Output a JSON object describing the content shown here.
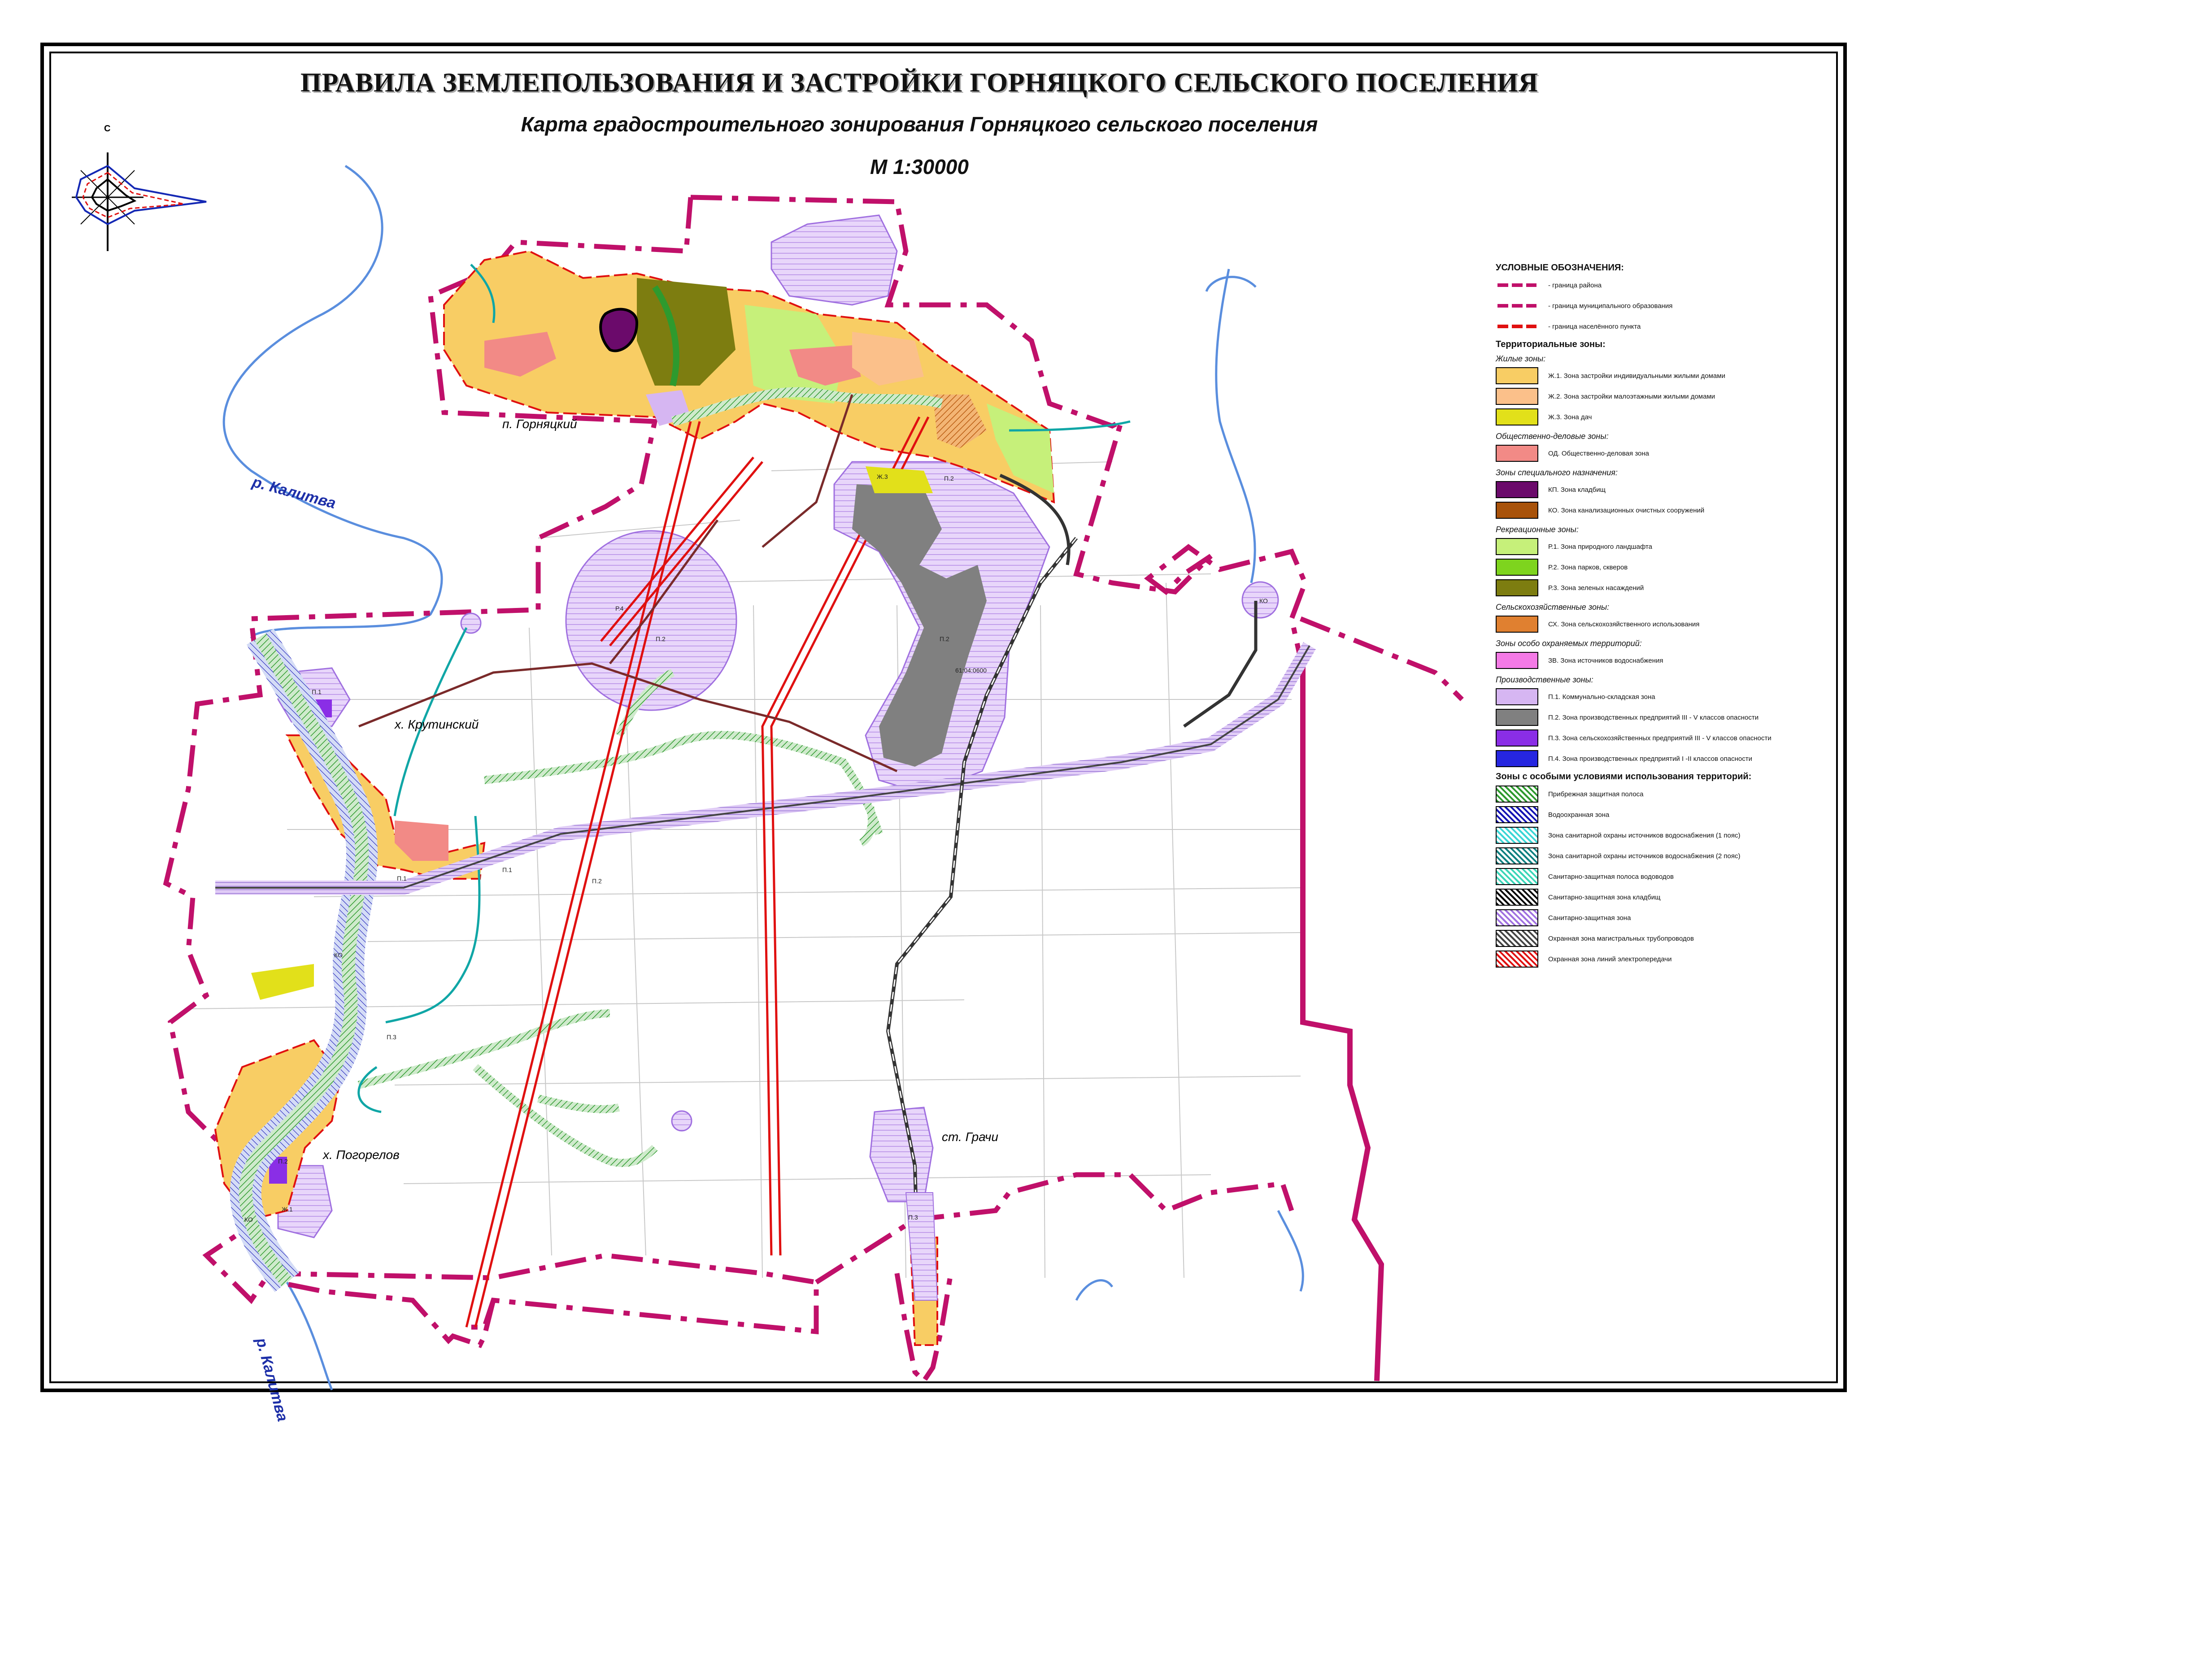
{
  "header": {
    "title": "ПРАВИЛА ЗЕМЛЕПОЛЬЗОВАНИЯ И ЗАСТРОЙКИ ГОРНЯЦКОГО СЕЛЬСКОГО ПОСЕЛЕНИЯ",
    "subtitle": "Карта градостроительного зонирования Горняцкого сельского поселения",
    "scale": "М 1:30000"
  },
  "compass": {
    "north_label": "С"
  },
  "places": {
    "gornyatsky": "п. Горняцкий",
    "krutinsky": "х. Крутинский",
    "pogorelov": "х. Погорелов",
    "grachi": "ст. Грачи"
  },
  "rivers": {
    "kalitva_north": "р. Калитва",
    "kalitva_south": "р. Калитва"
  },
  "map_codes": [
    "Ж.3",
    "П.2",
    "П.2",
    "П.2",
    "Р.4",
    "П.1",
    "КО",
    "П.1",
    "П.3",
    "П.2",
    "КО",
    "Ж.1",
    "П.3",
    "П.1",
    "КО",
    "П.2"
  ],
  "map_cadastre_label": "61:04:0600",
  "legend": {
    "title": "УСЛОВНЫЕ ОБОЗНАЧЕНИЯ:",
    "boundaries": [
      {
        "label": "- граница района",
        "color": "#c0106a"
      },
      {
        "label": "- граница муниципального образования",
        "color": "#c0106a"
      },
      {
        "label": "- граница населённого пункта",
        "color": "#e01010"
      }
    ],
    "territorial_title": "Территориальные зоны:",
    "groups": [
      {
        "name": "Жилые зоны:",
        "items": [
          {
            "label": "Ж.1. Зона застройки индивидуальными жилыми домами",
            "color": "#f8cd64"
          },
          {
            "label": "Ж.2. Зона застройки малоэтажными жилыми домами",
            "color": "#fbc08a"
          },
          {
            "label": "Ж.3. Зона дач",
            "color": "#e2e01a"
          }
        ]
      },
      {
        "name": "Общественно-деловые зоны:",
        "items": [
          {
            "label": "ОД. Общественно-деловая зона",
            "color": "#f28a86"
          }
        ]
      },
      {
        "name": "Зоны специального назначения:",
        "items": [
          {
            "label": "КП. Зона кладбищ",
            "color": "#6b0a6b"
          },
          {
            "label": "КО. Зона канализационных очистных сооружений",
            "color": "#a8520a"
          }
        ]
      },
      {
        "name": "Рекреационные зоны:",
        "items": [
          {
            "label": "Р.1. Зона природного ландшафта",
            "color": "#c6f07a"
          },
          {
            "label": "Р.2. Зона парков, скверов",
            "color": "#7ed41e"
          },
          {
            "label": "Р.3. Зона зеленых насаждений",
            "color": "#7d7d10"
          }
        ]
      },
      {
        "name": "Сельскохозяйственные зоны:",
        "items": [
          {
            "label": "СХ. Зона сельскохозяйственного использования",
            "color": "#e08030"
          }
        ]
      },
      {
        "name": "Зоны особо охраняемых территорий:",
        "items": [
          {
            "label": "ЗВ. Зона источников водоснабжения",
            "color": "#f47ae6"
          }
        ]
      },
      {
        "name": "Производственные зоны:",
        "items": [
          {
            "label": "П.1. Коммунально-складская зона",
            "color": "#d6b6f2"
          },
          {
            "label": "П.2. Зона производственных предприятий III - V классов опасности",
            "color": "#808080"
          },
          {
            "label": "П.3. Зона сельскохозяйственных предприятий III - V классов опасности",
            "color": "#8a2ee6"
          },
          {
            "label": "П.4. Зона производственных предприятий I -II классов опасности",
            "color": "#2626e0"
          }
        ]
      }
    ],
    "special_title": "Зоны с особыми условиями использования территорий:",
    "special": [
      {
        "label": "Прибрежная защитная полоса",
        "color": "#2e9a2e"
      },
      {
        "label": "Водоохранная зона",
        "color": "#1414b4"
      },
      {
        "label": "Зона санитарной охраны источников водоснабжения (1 пояс)",
        "color": "#3ad6d6"
      },
      {
        "label": "Зона санитарной охраны источников водоснабжения (2 пояс)",
        "color": "#108080"
      },
      {
        "label": "Санитарно-защитная полоса водоводов",
        "color": "#3ad6b8"
      },
      {
        "label": "Санитарно-защитная зона кладбищ",
        "color": "#000000"
      },
      {
        "label": "Санитарно-защитная зона",
        "color": "#a070e0"
      },
      {
        "label": "Охранная зона магистральных трубопроводов",
        "color": "#444444"
      },
      {
        "label": "Охранная зона линий электропередачи",
        "color": "#e01010"
      }
    ]
  }
}
